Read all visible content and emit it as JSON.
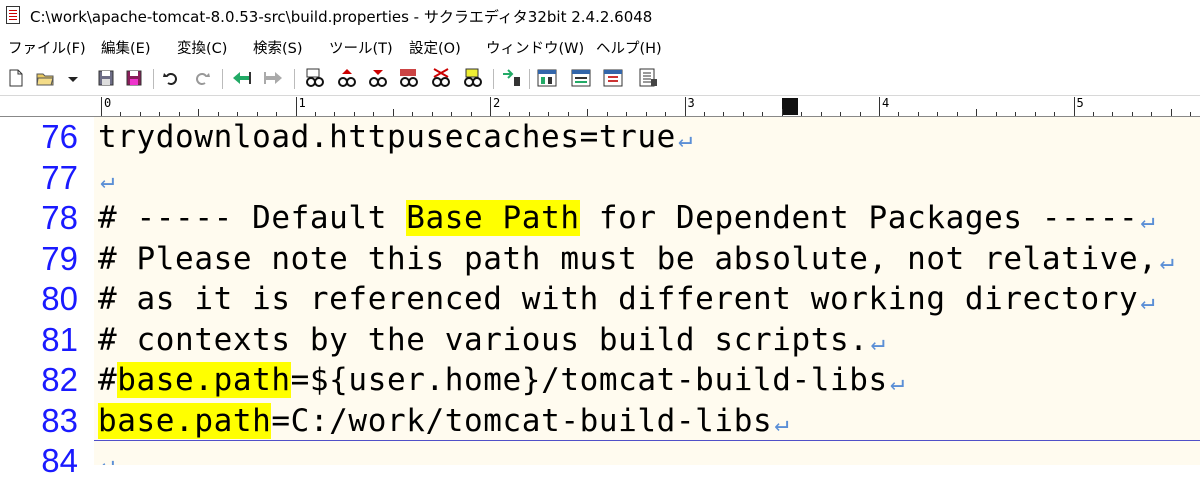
{
  "window": {
    "title": "C:\\work\\apache-tomcat-8.0.53-src\\build.properties - サクラエディタ32bit 2.4.2.6048"
  },
  "menu": [
    "ファイル(F)",
    "編集(E)",
    "変換(C)",
    "検索(S)",
    "ツール(T)",
    "設定(O)",
    "ウィンドウ(W)",
    "ヘルプ(H)"
  ],
  "toolbar_icons": [
    "new-file-icon",
    "open-folder-icon",
    "dropdown-arrow-icon",
    "save-icon",
    "save-all-icon",
    "undo-icon",
    "redo-icon",
    "jump-back-icon",
    "jump-forward-icon",
    "search-icon",
    "search-previous-icon",
    "search-next-icon",
    "grep-icon",
    "replace-icon",
    "bookmark-search-icon",
    "outline-icon",
    "compare-icon",
    "type-settings-icon",
    "common-settings-icon",
    "font-settings-icon",
    "window-list-icon"
  ],
  "ruler": {
    "labels": [
      "0",
      "1",
      "2",
      "3",
      "4",
      "5"
    ]
  },
  "eol_mark": "↵",
  "lines": [
    {
      "number": "76",
      "segments": [
        {
          "text": "trydownload.httpusecaches=true",
          "highlight": false
        }
      ]
    },
    {
      "number": "77",
      "segments": []
    },
    {
      "number": "78",
      "segments": [
        {
          "text": "# ----- Default ",
          "highlight": false
        },
        {
          "text": "Base Path",
          "highlight": true
        },
        {
          "text": " for Dependent Packages -----",
          "highlight": false
        }
      ]
    },
    {
      "number": "79",
      "segments": [
        {
          "text": "# Please note this path must be absolute, not relative,",
          "highlight": false
        }
      ]
    },
    {
      "number": "80",
      "segments": [
        {
          "text": "# as it is referenced with different working directory",
          "highlight": false
        }
      ]
    },
    {
      "number": "81",
      "segments": [
        {
          "text": "# contexts by the various build scripts.",
          "highlight": false
        }
      ]
    },
    {
      "number": "82",
      "segments": [
        {
          "text": "#",
          "highlight": false
        },
        {
          "text": "base.path",
          "highlight": true
        },
        {
          "text": "=${user.home}/tomcat-build-libs",
          "highlight": false
        }
      ]
    },
    {
      "number": "83",
      "segments": [
        {
          "text": "base.path",
          "highlight": true
        },
        {
          "text": "=C:/work/tomcat-build-libs",
          "highlight": false
        }
      ]
    },
    {
      "number": "84",
      "segments": []
    }
  ],
  "colors": {
    "line_number": "#1a1aff",
    "highlight": "#ffff00",
    "editor_background": "#fffbef",
    "eol_mark": "#5b8fd6"
  }
}
